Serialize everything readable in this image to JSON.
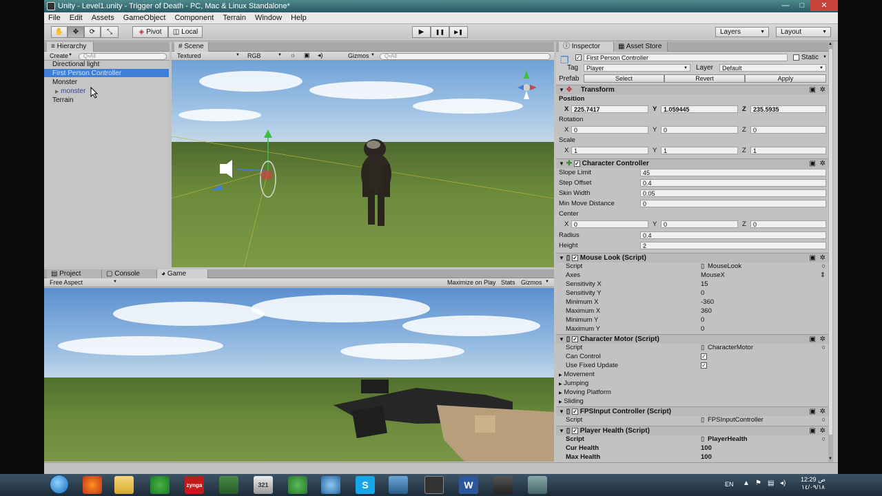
{
  "window": {
    "title": "Unity - Level1.unity - Trigger of Death - PC, Mac & Linux Standalone*"
  },
  "window_controls": {
    "minimize": "—",
    "maximize": "□",
    "close": "✕"
  },
  "menu": [
    "File",
    "Edit",
    "Assets",
    "GameObject",
    "Component",
    "Terrain",
    "Window",
    "Help"
  ],
  "toolbar": {
    "pivot": "Pivot",
    "local": "Local",
    "layers": "Layers",
    "layout": "Layout",
    "play": "▶",
    "pause": "❚❚",
    "step": "▶❚"
  },
  "hierarchy": {
    "tab": "Hierarchy",
    "create": "Create",
    "search_placeholder": "Q•All",
    "items": [
      {
        "label": "Directional light"
      },
      {
        "label": "First Person Controller"
      },
      {
        "label": "Monster"
      },
      {
        "label": "monster"
      },
      {
        "label": "Terrain"
      }
    ]
  },
  "scene": {
    "tab": "Scene",
    "render_mode": "Textured",
    "color_mode": "RGB",
    "gizmos": "Gizmos",
    "search_placeholder": "Q•All"
  },
  "bottom_tabs": {
    "project": "Project",
    "console": "Console",
    "game": "Game"
  },
  "game": {
    "aspect": "Free Aspect",
    "maximize": "Maximize on Play",
    "stats": "Stats",
    "gizmos": "Gizmos"
  },
  "inspector": {
    "tab": "Inspector",
    "asset_store_tab": "Asset Store",
    "object_name": "First Person Controller",
    "static_label": "Static",
    "tag_label": "Tag",
    "tag_value": "Player",
    "layer_label": "Layer",
    "layer_value": "Default",
    "prefab_label": "Prefab",
    "prefab_select": "Select",
    "prefab_revert": "Revert",
    "prefab_apply": "Apply",
    "transform": {
      "title": "Transform",
      "position_label": "Position",
      "position": {
        "x": "225.7417",
        "y": "1.059445",
        "z": "235.5935"
      },
      "rotation_label": "Rotation",
      "rotation": {
        "x": "0",
        "y": "0",
        "z": "0"
      },
      "scale_label": "Scale",
      "scale": {
        "x": "1",
        "y": "1",
        "z": "1"
      }
    },
    "character_controller": {
      "title": "Character Controller",
      "slope_limit_label": "Slope Limit",
      "slope_limit": "45",
      "step_offset_label": "Step Offset",
      "step_offset": "0.4",
      "skin_width_label": "Skin Width",
      "skin_width": "0.05",
      "min_move_label": "Min Move Distance",
      "min_move": "0",
      "center_label": "Center",
      "center": {
        "x": "0",
        "y": "0",
        "z": "0"
      },
      "radius_label": "Radius",
      "radius": "0.4",
      "height_label": "Height",
      "height": "2"
    },
    "mouse_look": {
      "title": "Mouse Look (Script)",
      "rows": [
        {
          "label": "Script",
          "value": "MouseLook"
        },
        {
          "label": "Axes",
          "value": "MouseX"
        },
        {
          "label": "Sensitivity X",
          "value": "15"
        },
        {
          "label": "Sensitivity Y",
          "value": "0"
        },
        {
          "label": "Minimum X",
          "value": "-360"
        },
        {
          "label": "Maximum X",
          "value": "360"
        },
        {
          "label": "Minimum Y",
          "value": "0"
        },
        {
          "label": "Maximum Y",
          "value": "0"
        }
      ]
    },
    "character_motor": {
      "title": "Character Motor (Script)",
      "script_label": "Script",
      "script_value": "CharacterMotor",
      "can_control_label": "Can Control",
      "use_fixed_label": "Use Fixed Update",
      "foldouts": [
        "Movement",
        "Jumping",
        "Moving Platform",
        "Sliding"
      ]
    },
    "fps_input": {
      "title": "FPSInput Controller (Script)",
      "script_label": "Script",
      "script_value": "FPSInputController"
    },
    "player_health": {
      "title": "Player Health (Script)",
      "script_label": "Script",
      "script_value": "PlayerHealth",
      "cur_label": "Cur Health",
      "cur_value": "100",
      "max_label": "Max Health",
      "max_value": "100"
    }
  },
  "taskbar": {
    "lang": "EN",
    "time": "12:29 ص",
    "date": "١٤/٠٩/١٨",
    "apps": [
      "firefox",
      "explorer",
      "chrome",
      "zynga",
      "notepad",
      "calendar",
      "utorrent",
      "itunes",
      "skype",
      "network",
      "unity",
      "word",
      "app",
      "app2"
    ],
    "labels": {
      "zynga": "zynga",
      "calendar": "321",
      "skype": "S",
      "word": "W"
    }
  }
}
